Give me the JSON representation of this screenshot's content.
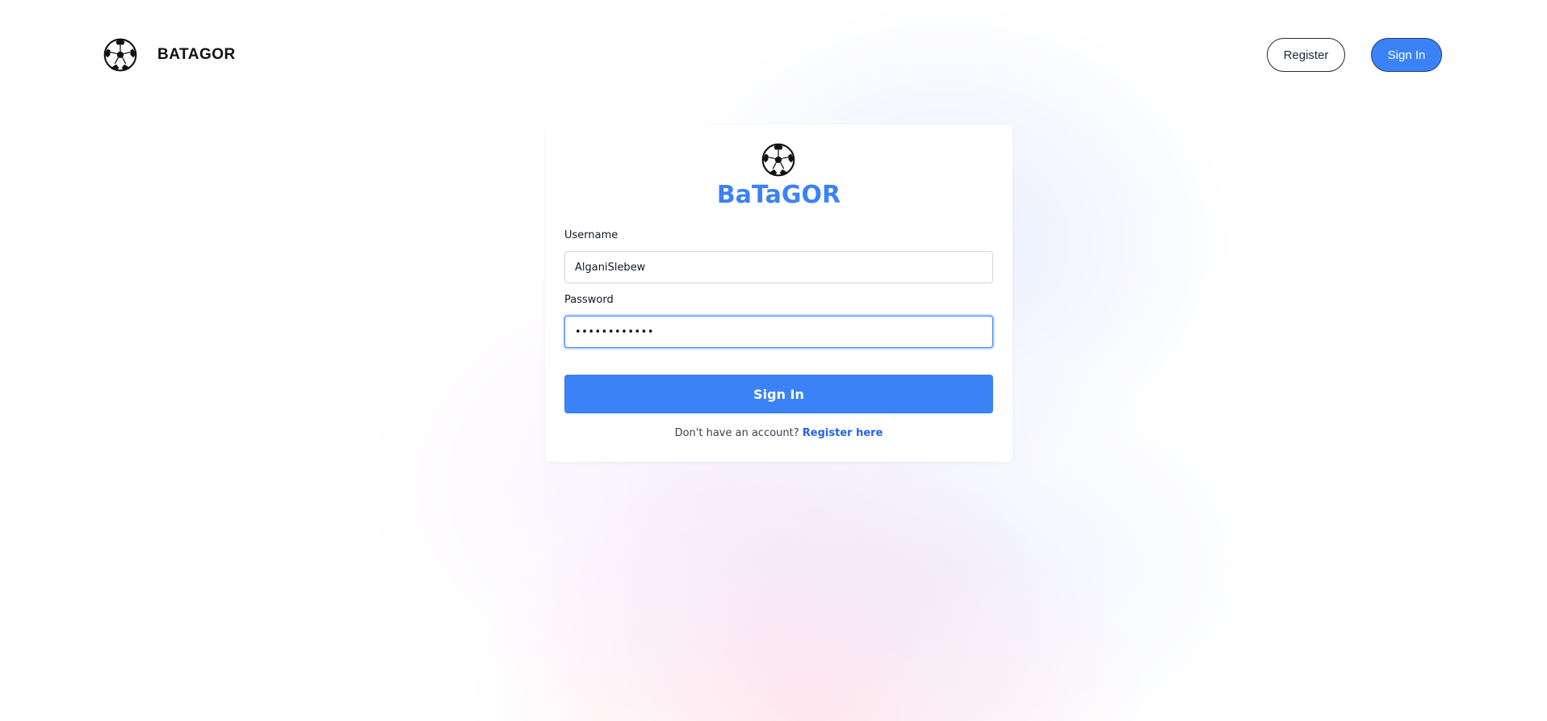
{
  "navbar": {
    "brand_name": "BATAGOR",
    "register_label": "Register",
    "signin_label": "Sign In"
  },
  "login_card": {
    "title": "BaTaGOR",
    "username_label": "Username",
    "username_value": "AlganiSlebew",
    "password_label": "Password",
    "password_value": "••••••••••••",
    "submit_label": "Sign In",
    "no_account_text": "Don't have an account?",
    "register_link": "Register here"
  },
  "icons": {
    "brand_logo": "soccer-ball-icon",
    "card_logo": "soccer-ball-icon"
  },
  "colors": {
    "accent": "#3b82f6",
    "link": "#2563eb"
  }
}
